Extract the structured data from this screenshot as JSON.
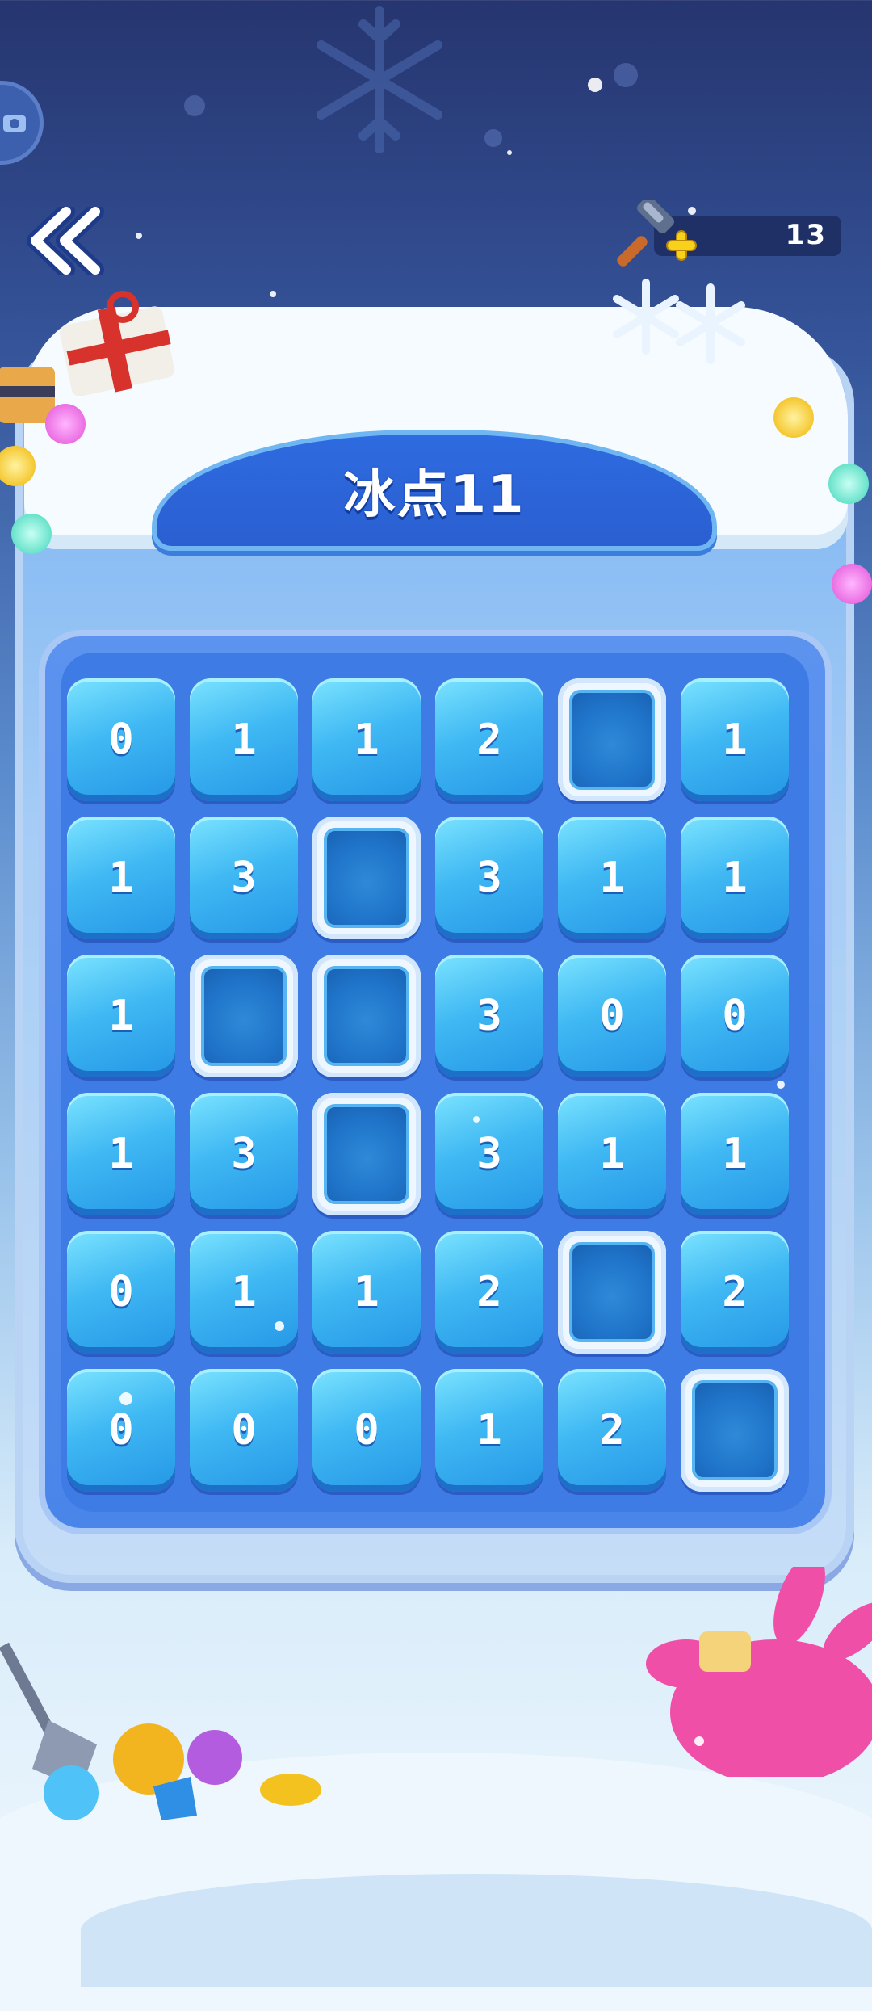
{
  "level_title": "冰点11",
  "hammer": {
    "count": "13"
  },
  "icons": {
    "back": "double-chevron-left-icon",
    "corner": "camera-icon",
    "hammer": "hammer-icon",
    "plus": "plus-icon",
    "ice_tile": "frozen-ice-tile-icon"
  },
  "board": {
    "rows": [
      [
        "0",
        "1",
        "1",
        "2",
        "ICE",
        "1"
      ],
      [
        "1",
        "3",
        "ICE",
        "3",
        "1",
        "1"
      ],
      [
        "1",
        "ICE",
        "ICE",
        "3",
        "0",
        "0"
      ],
      [
        "1",
        "3",
        "ICE",
        "3",
        "1",
        "1"
      ],
      [
        "0",
        "1",
        "1",
        "2",
        "ICE",
        "2"
      ],
      [
        "0",
        "0",
        "0",
        "1",
        "2",
        "ICE"
      ]
    ]
  },
  "colors": {
    "tile": "#3fb8f3",
    "board": "#3f7be4",
    "title_plate": "#2a5fd1"
  }
}
